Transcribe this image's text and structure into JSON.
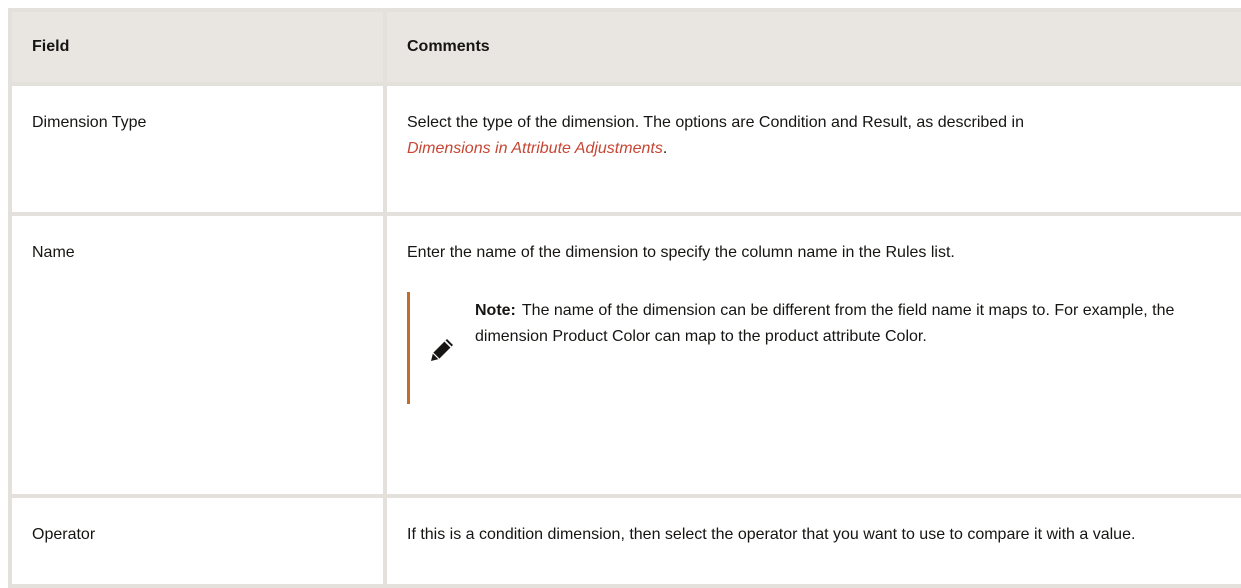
{
  "table": {
    "headers": {
      "field": "Field",
      "comments": "Comments"
    },
    "rows": [
      {
        "field": "Dimension Type",
        "comment_prefix": "Select the type of the dimension. The options are Condition and Result, as described in",
        "comment_link": "Dimensions in Attribute Adjustments",
        "comment_suffix": "."
      },
      {
        "field": "Name",
        "comment": "Enter the name of the dimension to specify the column name in the Rules list.",
        "note": {
          "label": "Note:",
          "text": "The name of the dimension can be different from the field name it maps to. For example, the dimension Product Color can map to the product attribute Color.",
          "icon": "pencil-icon"
        }
      },
      {
        "field": "Operator",
        "comment": "If this is a condition dimension, then select the operator that you want to use to compare it with a value."
      }
    ]
  },
  "colors": {
    "link": "#c74634",
    "note_bar": "#c06c2a",
    "header_bg": "#e9e6e1",
    "border": "#e4e1dc"
  }
}
